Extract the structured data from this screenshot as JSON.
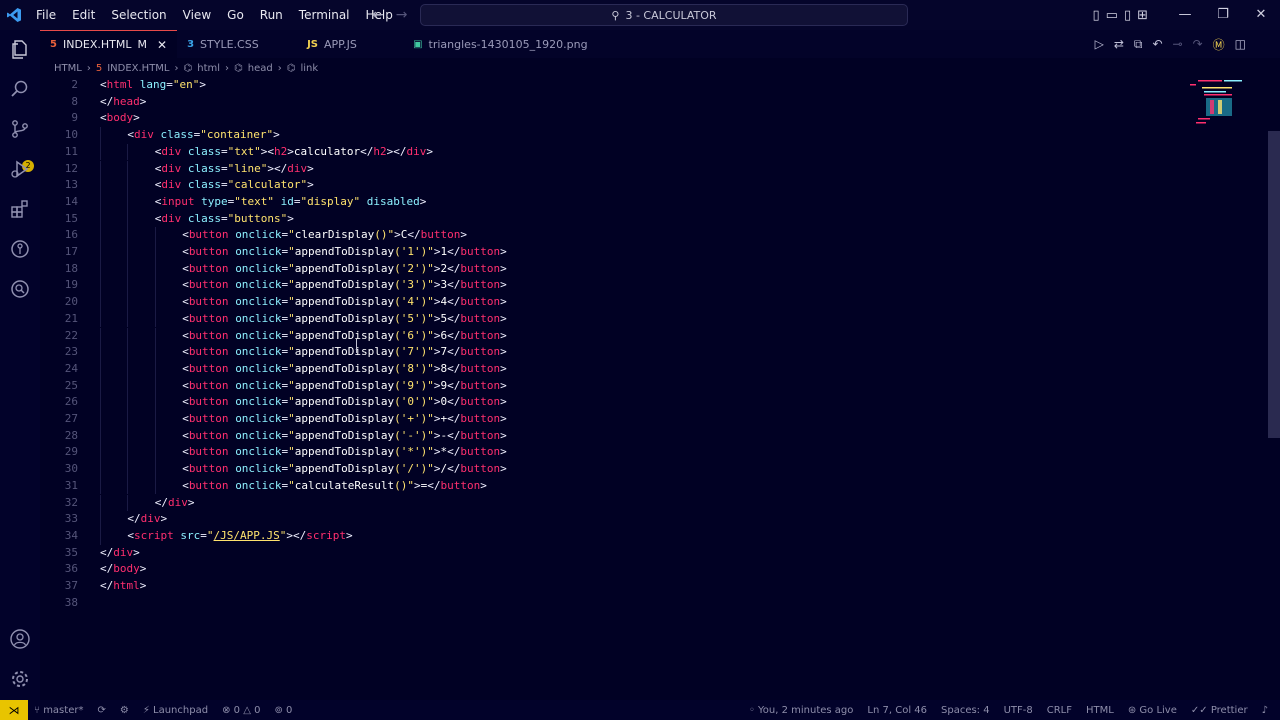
{
  "menu": [
    "File",
    "Edit",
    "Selection",
    "View",
    "Go",
    "Run",
    "Terminal",
    "Help"
  ],
  "window_title": "3 - CALCULATOR",
  "tabs": [
    {
      "label": "INDEX.HTML",
      "modified": "M",
      "icon": "html5-icon",
      "active": true
    },
    {
      "label": "STYLE.CSS",
      "icon": "css3-icon",
      "active": false
    },
    {
      "label": "APP.JS",
      "icon_text": "JS",
      "active": false
    },
    {
      "label": "triangles-1430105_1920.png",
      "icon": "image-icon",
      "active": false
    }
  ],
  "breadcrumb": [
    "HTML",
    "INDEX.HTML",
    "html",
    "head",
    "link"
  ],
  "editor": {
    "lines": [
      {
        "n": "2",
        "indent": 0,
        "html": "<span class='p'>&lt;</span><span class='t'>html</span> <span class='a'>lang</span><span class='p'>=</span><span class='s'>\"en\"</span><span class='p'>&gt;</span>"
      },
      {
        "n": "8",
        "indent": 0,
        "html": "<span class='p'>&lt;/</span><span class='t'>head</span><span class='p'>&gt;</span>"
      },
      {
        "n": "9",
        "indent": 0,
        "html": "<span class='p'>&lt;</span><span class='t'>body</span><span class='p'>&gt;</span>"
      },
      {
        "n": "10",
        "indent": 1,
        "html": "<span class='p'>&lt;</span><span class='t'>div</span> <span class='a'>class</span><span class='p'>=</span><span class='s'>\"container\"</span><span class='p'>&gt;</span>"
      },
      {
        "n": "11",
        "indent": 2,
        "html": "<span class='p'>&lt;</span><span class='t'>div</span> <span class='a'>class</span><span class='p'>=</span><span class='s'>\"txt\"</span><span class='p'>&gt;&lt;</span><span class='t'>h2</span><span class='p'>&gt;</span><span class='x'>calculator</span><span class='p'>&lt;/</span><span class='t'>h2</span><span class='p'>&gt;&lt;/</span><span class='t'>div</span><span class='p'>&gt;</span>"
      },
      {
        "n": "12",
        "indent": 2,
        "html": "<span class='p'>&lt;</span><span class='t'>div</span> <span class='a'>class</span><span class='p'>=</span><span class='s'>\"line\"</span><span class='p'>&gt;&lt;/</span><span class='t'>div</span><span class='p'>&gt;</span>"
      },
      {
        "n": "13",
        "indent": 2,
        "html": "<span class='p'>&lt;</span><span class='t'>div</span> <span class='a'>class</span><span class='p'>=</span><span class='s'>\"calculator\"</span><span class='p'>&gt;</span>"
      },
      {
        "n": "14",
        "indent": 2,
        "html": "<span class='p'>&lt;</span><span class='t'>input</span> <span class='a'>type</span><span class='p'>=</span><span class='s'>\"text\"</span> <span class='a'>id</span><span class='p'>=</span><span class='s'>\"display\"</span> <span class='a'>disabled</span><span class='p'>&gt;</span>"
      },
      {
        "n": "15",
        "indent": 2,
        "html": "<span class='p'>&lt;</span><span class='t'>div</span> <span class='a'>class</span><span class='p'>=</span><span class='s'>\"buttons\"</span><span class='p'>&gt;</span>"
      },
      {
        "n": "16",
        "indent": 3,
        "html": "<span class='p'>&lt;</span><span class='t'>button</span> <span class='a'>onclick</span><span class='p'>=</span><span class='s'>\"</span><span class='x'>clearDisplay</span><span class='s'>()\"</span><span class='p'>&gt;</span><span class='x'>C</span><span class='p'>&lt;/</span><span class='t'>button</span><span class='p'>&gt;</span>"
      },
      {
        "n": "17",
        "indent": 3,
        "html": "<span class='p'>&lt;</span><span class='t'>button</span> <span class='a'>onclick</span><span class='p'>=</span><span class='s'>\"</span><span class='x'>appendToDisplay</span><span class='s'>('1')\"</span><span class='p'>&gt;</span><span class='x'>1</span><span class='p'>&lt;/</span><span class='t'>button</span><span class='p'>&gt;</span>"
      },
      {
        "n": "18",
        "indent": 3,
        "html": "<span class='p'>&lt;</span><span class='t'>button</span> <span class='a'>onclick</span><span class='p'>=</span><span class='s'>\"</span><span class='x'>appendToDisplay</span><span class='s'>('2')\"</span><span class='p'>&gt;</span><span class='x'>2</span><span class='p'>&lt;/</span><span class='t'>button</span><span class='p'>&gt;</span>"
      },
      {
        "n": "19",
        "indent": 3,
        "html": "<span class='p'>&lt;</span><span class='t'>button</span> <span class='a'>onclick</span><span class='p'>=</span><span class='s'>\"</span><span class='x'>appendToDisplay</span><span class='s'>('3')\"</span><span class='p'>&gt;</span><span class='x'>3</span><span class='p'>&lt;/</span><span class='t'>button</span><span class='p'>&gt;</span>"
      },
      {
        "n": "20",
        "indent": 3,
        "html": "<span class='p'>&lt;</span><span class='t'>button</span> <span class='a'>onclick</span><span class='p'>=</span><span class='s'>\"</span><span class='x'>appendToDisplay</span><span class='s'>('4')\"</span><span class='p'>&gt;</span><span class='x'>4</span><span class='p'>&lt;/</span><span class='t'>button</span><span class='p'>&gt;</span>"
      },
      {
        "n": "21",
        "indent": 3,
        "html": "<span class='p'>&lt;</span><span class='t'>button</span> <span class='a'>onclick</span><span class='p'>=</span><span class='s'>\"</span><span class='x'>appendToDisplay</span><span class='s'>('5')\"</span><span class='p'>&gt;</span><span class='x'>5</span><span class='p'>&lt;/</span><span class='t'>button</span><span class='p'>&gt;</span>"
      },
      {
        "n": "22",
        "indent": 3,
        "html": "<span class='p'>&lt;</span><span class='t'>button</span> <span class='a'>onclick</span><span class='p'>=</span><span class='s'>\"</span><span class='x'>appendToDisplay</span><span class='s'>('6')\"</span><span class='p'>&gt;</span><span class='x'>6</span><span class='p'>&lt;/</span><span class='t'>button</span><span class='p'>&gt;</span>"
      },
      {
        "n": "23",
        "indent": 3,
        "html": "<span class='p'>&lt;</span><span class='t'>button</span> <span class='a'>onclick</span><span class='p'>=</span><span class='s'>\"</span><span class='x'>appendToDisplay</span><span class='s'>('7')\"</span><span class='p'>&gt;</span><span class='x'>7</span><span class='p'>&lt;/</span><span class='t'>button</span><span class='p'>&gt;</span>"
      },
      {
        "n": "24",
        "indent": 3,
        "html": "<span class='p'>&lt;</span><span class='t'>button</span> <span class='a'>onclick</span><span class='p'>=</span><span class='s'>\"</span><span class='x'>appendToDisplay</span><span class='s'>('8')\"</span><span class='p'>&gt;</span><span class='x'>8</span><span class='p'>&lt;/</span><span class='t'>button</span><span class='p'>&gt;</span>"
      },
      {
        "n": "25",
        "indent": 3,
        "html": "<span class='p'>&lt;</span><span class='t'>button</span> <span class='a'>onclick</span><span class='p'>=</span><span class='s'>\"</span><span class='x'>appendToDisplay</span><span class='s'>('9')\"</span><span class='p'>&gt;</span><span class='x'>9</span><span class='p'>&lt;/</span><span class='t'>button</span><span class='p'>&gt;</span>"
      },
      {
        "n": "26",
        "indent": 3,
        "html": "<span class='p'>&lt;</span><span class='t'>button</span> <span class='a'>onclick</span><span class='p'>=</span><span class='s'>\"</span><span class='x'>appendToDisplay</span><span class='s'>('0')\"</span><span class='p'>&gt;</span><span class='x'>0</span><span class='p'>&lt;/</span><span class='t'>button</span><span class='p'>&gt;</span>"
      },
      {
        "n": "27",
        "indent": 3,
        "html": "<span class='p'>&lt;</span><span class='t'>button</span> <span class='a'>onclick</span><span class='p'>=</span><span class='s'>\"</span><span class='x'>appendToDisplay</span><span class='s'>('+')\"</span><span class='p'>&gt;</span><span class='x'>+</span><span class='p'>&lt;/</span><span class='t'>button</span><span class='p'>&gt;</span>"
      },
      {
        "n": "28",
        "indent": 3,
        "html": "<span class='p'>&lt;</span><span class='t'>button</span> <span class='a'>onclick</span><span class='p'>=</span><span class='s'>\"</span><span class='x'>appendToDisplay</span><span class='s'>('-')\"</span><span class='p'>&gt;</span><span class='x'>-</span><span class='p'>&lt;/</span><span class='t'>button</span><span class='p'>&gt;</span>"
      },
      {
        "n": "29",
        "indent": 3,
        "html": "<span class='p'>&lt;</span><span class='t'>button</span> <span class='a'>onclick</span><span class='p'>=</span><span class='s'>\"</span><span class='x'>appendToDisplay</span><span class='s'>('*')\"</span><span class='p'>&gt;</span><span class='x'>*</span><span class='p'>&lt;/</span><span class='t'>button</span><span class='p'>&gt;</span>"
      },
      {
        "n": "30",
        "indent": 3,
        "html": "<span class='p'>&lt;</span><span class='t'>button</span> <span class='a'>onclick</span><span class='p'>=</span><span class='s'>\"</span><span class='x'>appendToDisplay</span><span class='s'>('/')\"</span><span class='p'>&gt;</span><span class='x'>/</span><span class='p'>&lt;/</span><span class='t'>button</span><span class='p'>&gt;</span>"
      },
      {
        "n": "31",
        "indent": 3,
        "html": "<span class='p'>&lt;</span><span class='t'>button</span> <span class='a'>onclick</span><span class='p'>=</span><span class='s'>\"</span><span class='x'>calculateResult</span><span class='s'>()\"</span><span class='p'>&gt;</span><span class='x'>=</span><span class='p'>&lt;/</span><span class='t'>button</span><span class='p'>&gt;</span>"
      },
      {
        "n": "32",
        "indent": 2,
        "html": "<span class='p'>&lt;/</span><span class='t'>div</span><span class='p'>&gt;</span>"
      },
      {
        "n": "33",
        "indent": 1,
        "html": "<span class='p'>&lt;/</span><span class='t'>div</span><span class='p'>&gt;</span>"
      },
      {
        "n": "34",
        "indent": 1,
        "html": "<span class='p'>&lt;</span><span class='t'>script</span> <span class='a'>src</span><span class='p'>=</span><span class='s'>\"</span><span class='s u'>/JS/APP.JS</span><span class='s'>\"</span><span class='p'>&gt;&lt;/</span><span class='t'>script</span><span class='p'>&gt;</span>"
      },
      {
        "n": "35",
        "indent": 0,
        "html": "<span class='p'>&lt;/</span><span class='t'>div</span><span class='p'>&gt;</span>"
      },
      {
        "n": "36",
        "indent": 0,
        "html": "<span class='p'>&lt;/</span><span class='t'>body</span><span class='p'>&gt;</span>"
      },
      {
        "n": "37",
        "indent": 0,
        "html": "<span class='p'>&lt;/</span><span class='t'>html</span><span class='p'>&gt;</span>"
      },
      {
        "n": "38",
        "indent": 0,
        "html": ""
      }
    ]
  },
  "status": {
    "branch": "master*",
    "launchpad": "Launchpad",
    "errors": "0",
    "warnings": "0",
    "ports": "0",
    "blame": "You, 2 minutes ago",
    "position": "Ln 7, Col 46",
    "spaces": "Spaces: 4",
    "encoding": "UTF-8",
    "eol": "CRLF",
    "language": "HTML",
    "golive": "Go Live",
    "prettier": "Prettier"
  },
  "scm_badge": "2"
}
